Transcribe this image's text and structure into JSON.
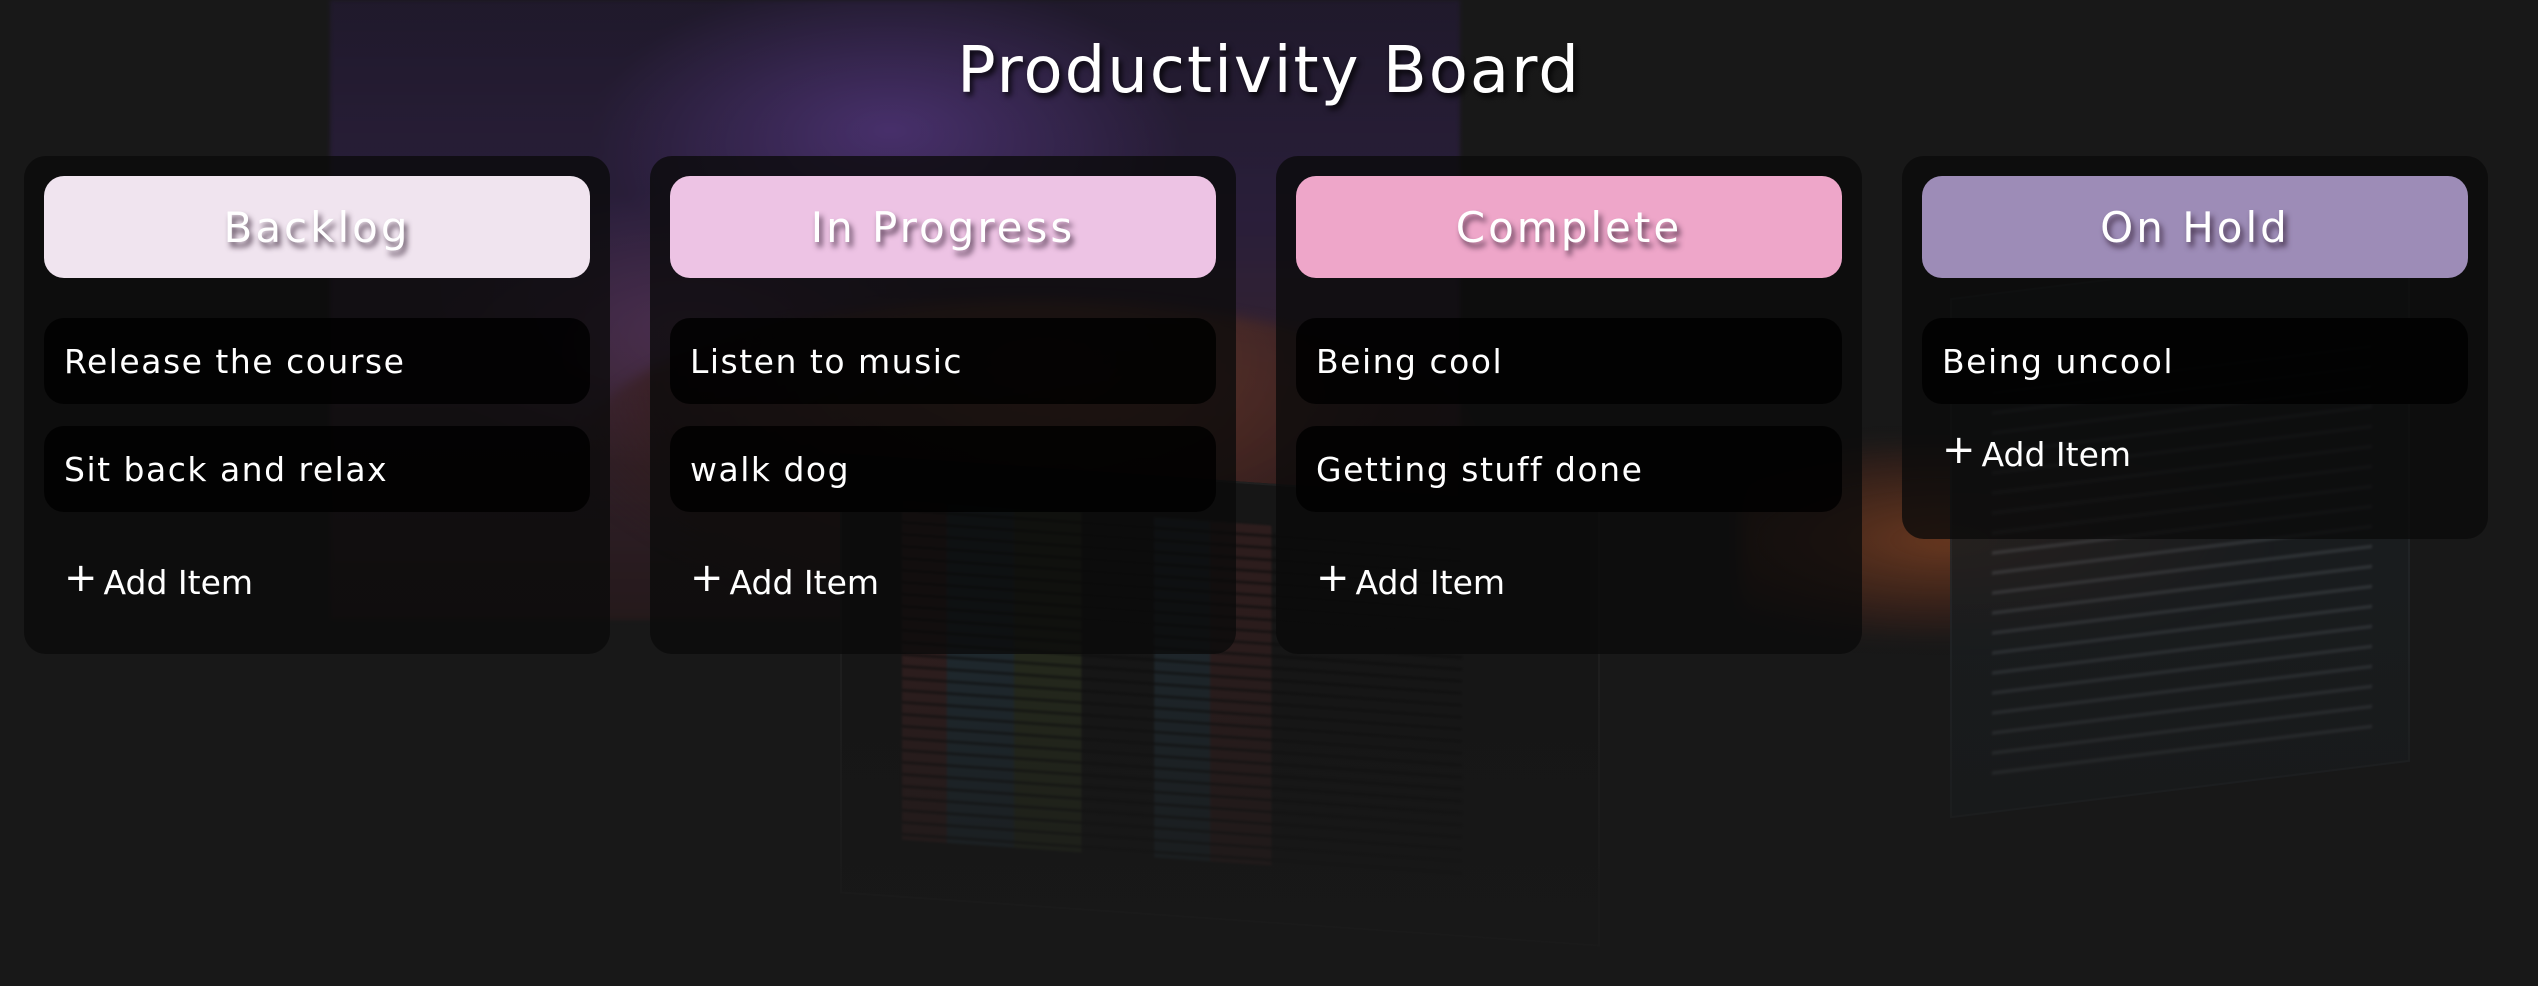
{
  "page": {
    "title": "Productivity Board"
  },
  "columns": [
    {
      "title": "Backlog",
      "header_color": "#f0e4ef",
      "items": [
        "Release the course",
        "Sit back and relax"
      ],
      "add_label": "Add Item"
    },
    {
      "title": "In Progress",
      "header_color": "#edc3e4",
      "items": [
        "Listen to music",
        "walk dog"
      ],
      "add_label": "Add Item"
    },
    {
      "title": "Complete",
      "header_color": "#eea6c9",
      "items": [
        "Being cool",
        "Getting stuff done"
      ],
      "add_label": "Add Item"
    },
    {
      "title": "On Hold",
      "header_color": "#9d8cb7",
      "items": [
        "Being uncool"
      ],
      "add_label": "Add Item"
    }
  ],
  "icons": {
    "add": "+"
  }
}
